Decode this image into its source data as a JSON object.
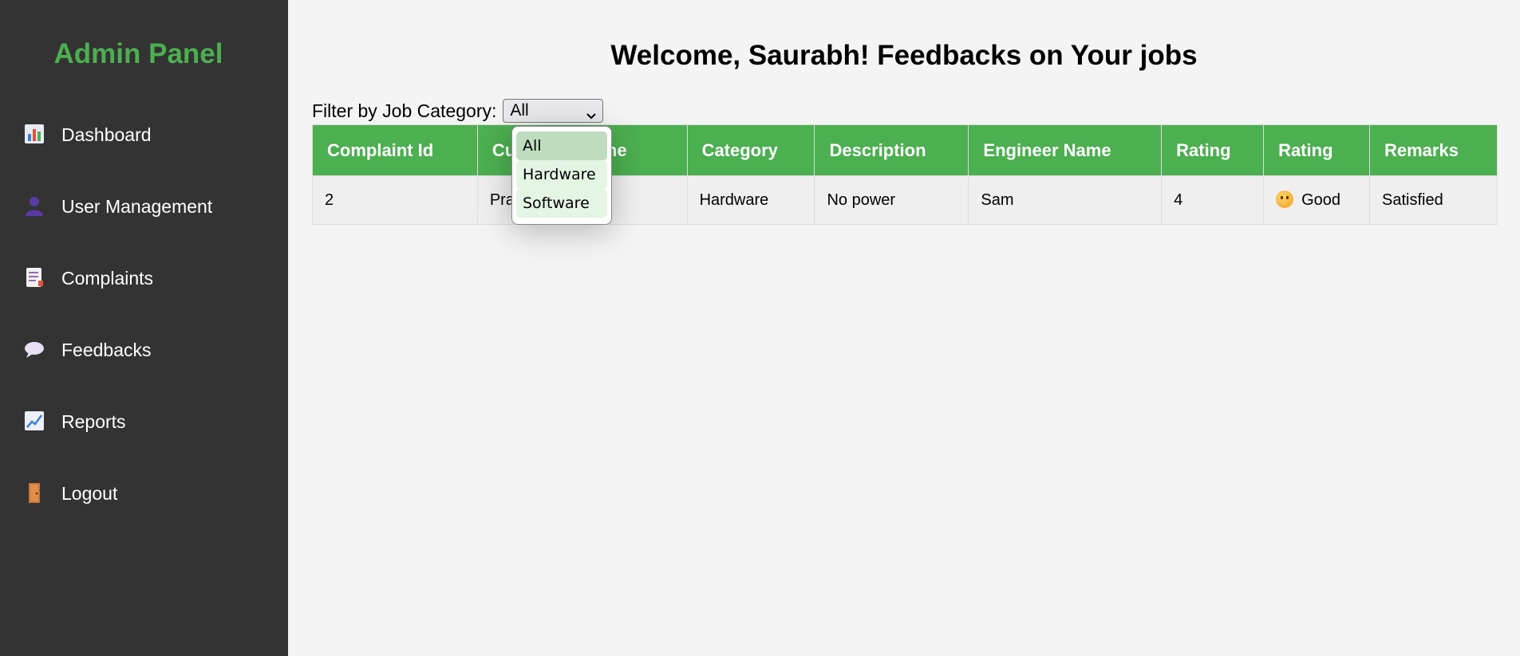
{
  "sidebar": {
    "brand": "Admin Panel",
    "items": [
      {
        "label": "Dashboard",
        "icon": "bar-chart-icon"
      },
      {
        "label": "User Management",
        "icon": "user-icon"
      },
      {
        "label": "Complaints",
        "icon": "document-icon"
      },
      {
        "label": "Feedbacks",
        "icon": "speech-bubble-icon"
      },
      {
        "label": "Reports",
        "icon": "line-chart-icon"
      },
      {
        "label": "Logout",
        "icon": "door-icon"
      }
    ]
  },
  "main": {
    "title": "Welcome, Saurabh! Feedbacks on Your jobs",
    "filter": {
      "label": "Filter by Job Category:",
      "selected": "All",
      "options": [
        "All",
        "Hardware",
        "Software"
      ]
    },
    "table": {
      "headers": [
        "Complaint Id",
        "Customer Name",
        "Category",
        "Description",
        "Engineer Name",
        "Rating",
        "Rating",
        "Remarks"
      ],
      "rows": [
        {
          "complaint_id": "2",
          "customer_name": "Pratik Bhapa",
          "category": "Hardware",
          "description": "No power",
          "engineer_name": "Sam",
          "rating": "4",
          "rating_text": "Good",
          "remarks": "Satisfied"
        }
      ]
    }
  },
  "colors": {
    "accent": "#4caf50",
    "sidebar_bg": "#333333",
    "page_bg": "#f4f4f4"
  }
}
